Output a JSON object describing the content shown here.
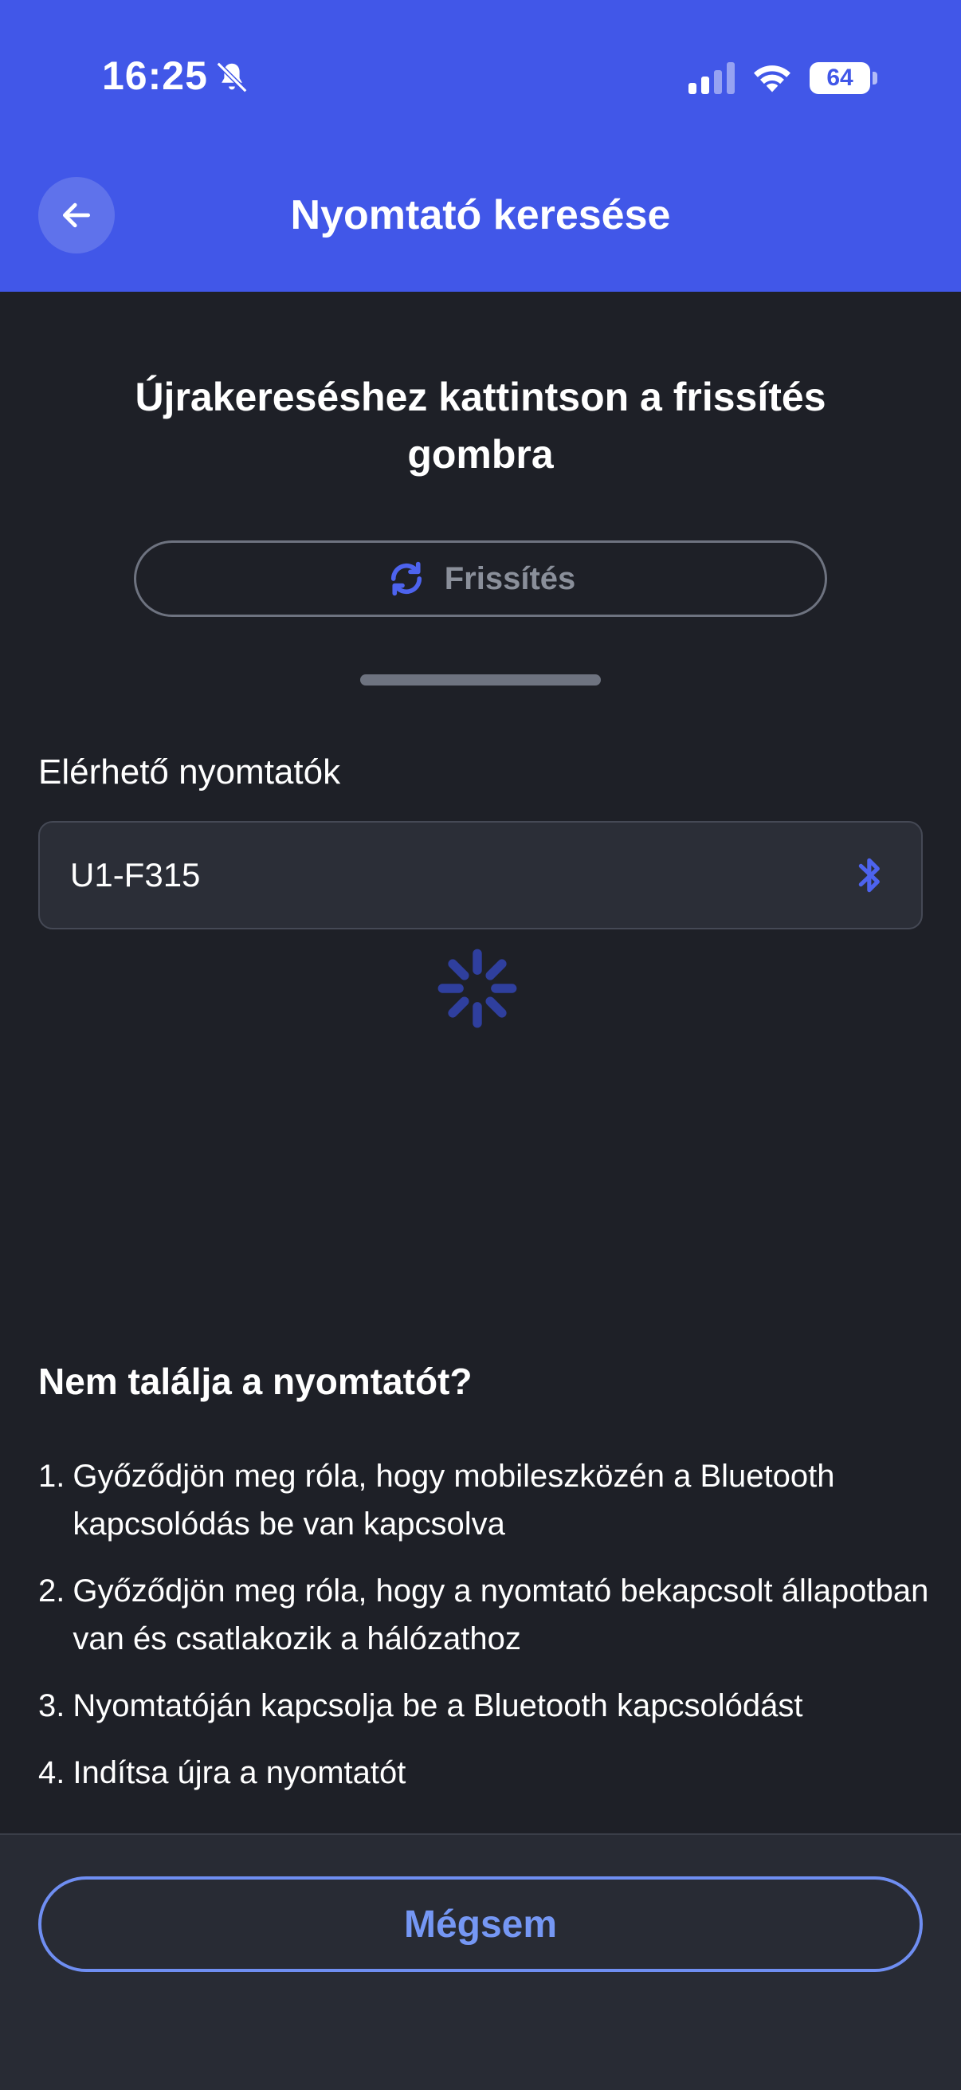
{
  "status_bar": {
    "time": "16:25",
    "battery": "64",
    "icons": [
      "bell-slash-icon",
      "cellular-signal-icon",
      "wifi-icon",
      "battery-icon"
    ]
  },
  "header": {
    "title": "Nyomtató keresése",
    "back_icon": "arrow-left-icon",
    "background_color": "#4157e8"
  },
  "instruction": "Újrakereséshez kattintson a frissítés gombra",
  "refresh_button": {
    "label": "Frissítés",
    "icon": "refresh-icon"
  },
  "available_printers": {
    "label": "Elérhető nyomtatók",
    "items": [
      {
        "name": "U1-F315",
        "icon": "bluetooth-icon"
      }
    ],
    "loading": true
  },
  "help": {
    "title": "Nem találja a nyomtatót?",
    "items": [
      {
        "num": "1.",
        "text": "Győződjön meg róla, hogy mobileszközén a Bluetooth kapcsolódás be van kapcsolva"
      },
      {
        "num": "2.",
        "text": "Győződjön meg róla, hogy a nyomtató bekapcsolt állapotban van és csatlakozik a hálózathoz"
      },
      {
        "num": "3.",
        "text": "Nyomtatóján kapcsolja be a Bluetooth kapcsolódást"
      },
      {
        "num": "4.",
        "text": "Indítsa újra a nyomtatót"
      }
    ]
  },
  "cancel_button": {
    "label": "Mégsem",
    "color": "#7597f4"
  }
}
